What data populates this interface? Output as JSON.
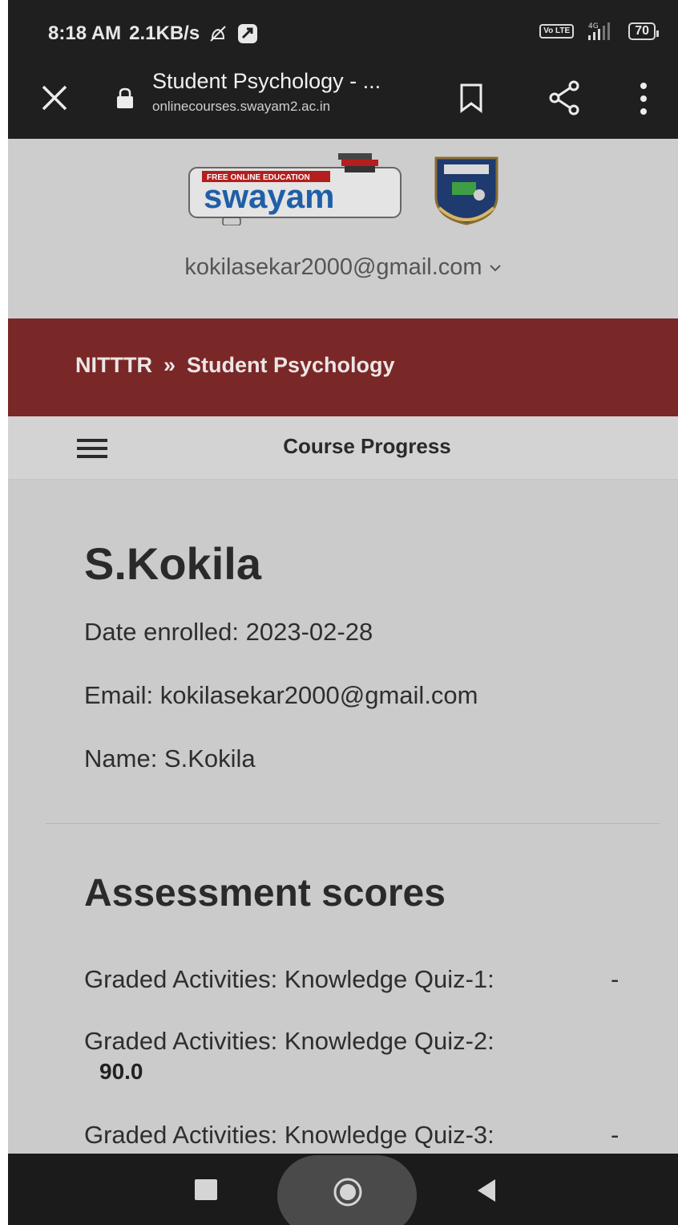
{
  "status_bar": {
    "time": "8:18 AM",
    "net_speed": "2.1KB/s",
    "volte": "Vo LTE",
    "network": "4G",
    "battery": "70"
  },
  "browser": {
    "page_title": "Student Psychology - ...",
    "url": "onlinecourses.swayam2.ac.in"
  },
  "header": {
    "logo_text": "swayam",
    "logo_tag": "FREE ONLINE EDUCATION",
    "user_email": "kokilasekar2000@gmail.com"
  },
  "breadcrumb": {
    "org": "NITTTR",
    "separator": "»",
    "course": "Student Psychology"
  },
  "nav": {
    "title": "Course Progress"
  },
  "student": {
    "name": "S.Kokila",
    "date_enrolled": "Date enrolled: 2023-02-28",
    "email": "Email: kokilasekar2000@gmail.com",
    "name_line": "Name: S.Kokila"
  },
  "assessment": {
    "title": "Assessment scores",
    "rows": [
      {
        "label": "Graded Activities: Knowledge Quiz-1:",
        "score": "-"
      },
      {
        "label": "Graded Activities: Knowledge Quiz-2:",
        "score": "90.0"
      },
      {
        "label": "Graded Activities: Knowledge Quiz-3:",
        "score": "-"
      }
    ]
  },
  "colors": {
    "breadcrumb_bg": "#7a2727",
    "browser_bg": "#1f1f1f",
    "content_bg": "#cbcbcb"
  }
}
